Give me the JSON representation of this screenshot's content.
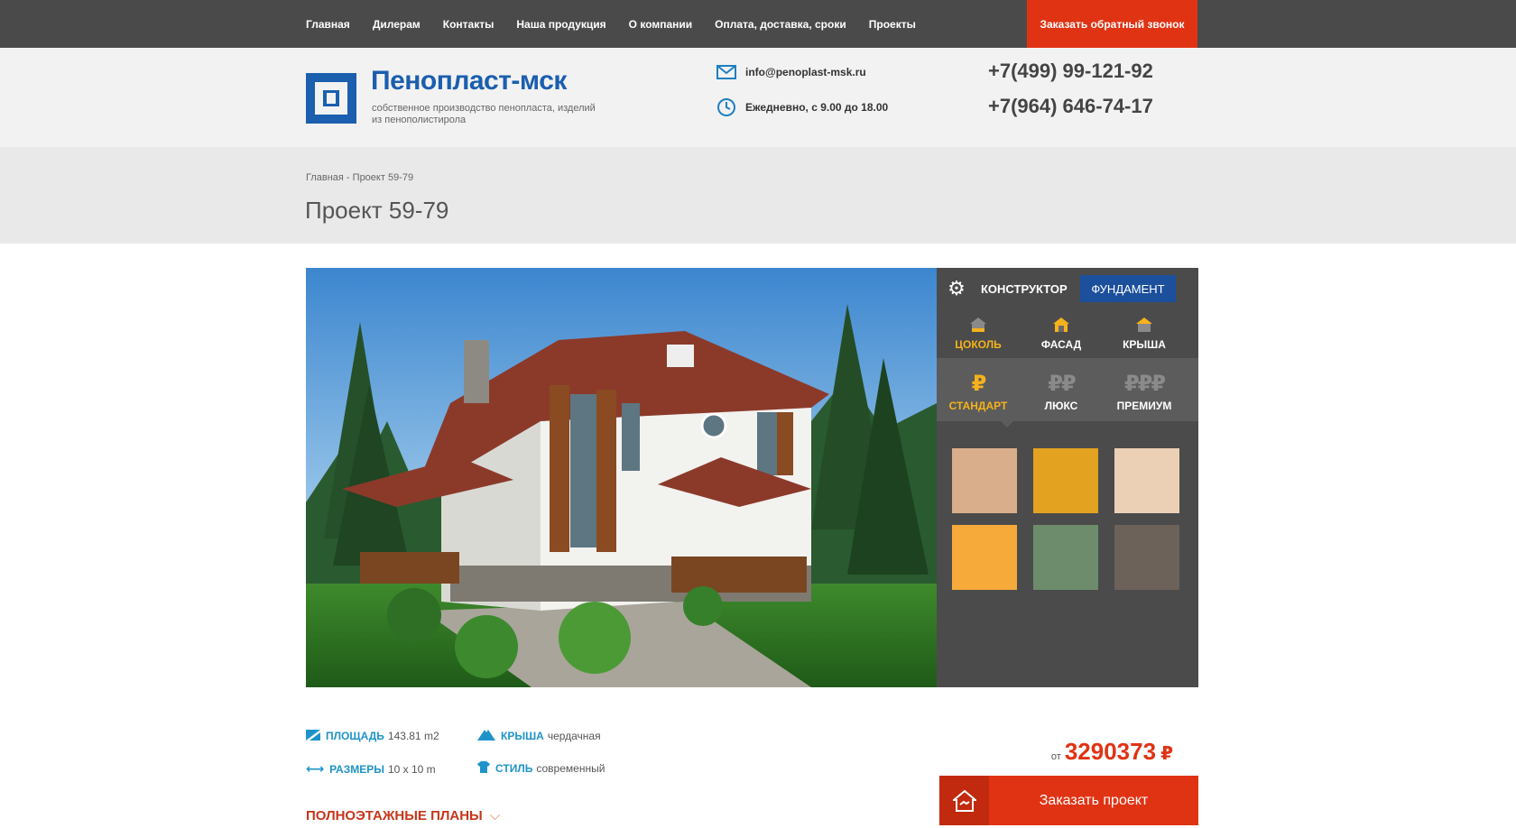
{
  "nav": {
    "items": [
      "Главная",
      "Дилерам",
      "Контакты",
      "Наша продукция",
      "О компании",
      "Оплата, доставка, сроки",
      "Проекты"
    ],
    "callback_label": "Заказать обратный звонок"
  },
  "header": {
    "brand": "Пенопласт-мск",
    "tagline": "собственное производство пенопласта, изделий из пенополистирола",
    "email": "info@penoplast-msk.ru",
    "hours": "Ежедневно, с 9.00 до 18.00",
    "phone1": "+7(499) 99-121-92",
    "phone2": "+7(964) 646-74-17"
  },
  "breadcrumb": {
    "home": "Главная",
    "separator": " - ",
    "current": "Проект 59-79"
  },
  "page_title": "Проект 59-79",
  "constructor": {
    "title": "КОНСТРУКТОР",
    "foundation_label": "ФУНДАМЕНТ",
    "parts": [
      {
        "label": "ЦОКОЛЬ",
        "icon": "house-icon",
        "active": true
      },
      {
        "label": "ФАСАД",
        "icon": "house-icon",
        "active": false
      },
      {
        "label": "КРЫША",
        "icon": "house-icon",
        "active": false
      }
    ],
    "tiers": [
      {
        "label": "СТАНДАРТ",
        "symbol": "₽",
        "active": true
      },
      {
        "label": "ЛЮКС",
        "symbol": "₽₽",
        "active": false
      },
      {
        "label": "ПРЕМИУМ",
        "symbol": "₽₽₽",
        "active": false
      }
    ],
    "swatches": [
      "#d9ae8a",
      "#e3a21f",
      "#ecd0b6",
      "#f6aa3a",
      "#6c8c6b",
      "#6d625a"
    ]
  },
  "specs": {
    "area_label": "ПЛОЩАДЬ",
    "area_value": "143.81 m2",
    "size_label": "РАЗМЕРЫ",
    "size_value": "10 x 10 m",
    "roof_label": "КРЫША",
    "roof_value": "чердачная",
    "style_label": "СТИЛЬ",
    "style_value": "современный"
  },
  "plans_label": "ПОЛНОЭТАЖНЫЕ ПЛАНЫ",
  "price": {
    "from": "от",
    "value": "3290373",
    "currency": "₽"
  },
  "order_label": "Заказать проект",
  "colors": {
    "accent": "#e03314",
    "brand": "#1b5fae",
    "highlight": "#f6b21c"
  }
}
